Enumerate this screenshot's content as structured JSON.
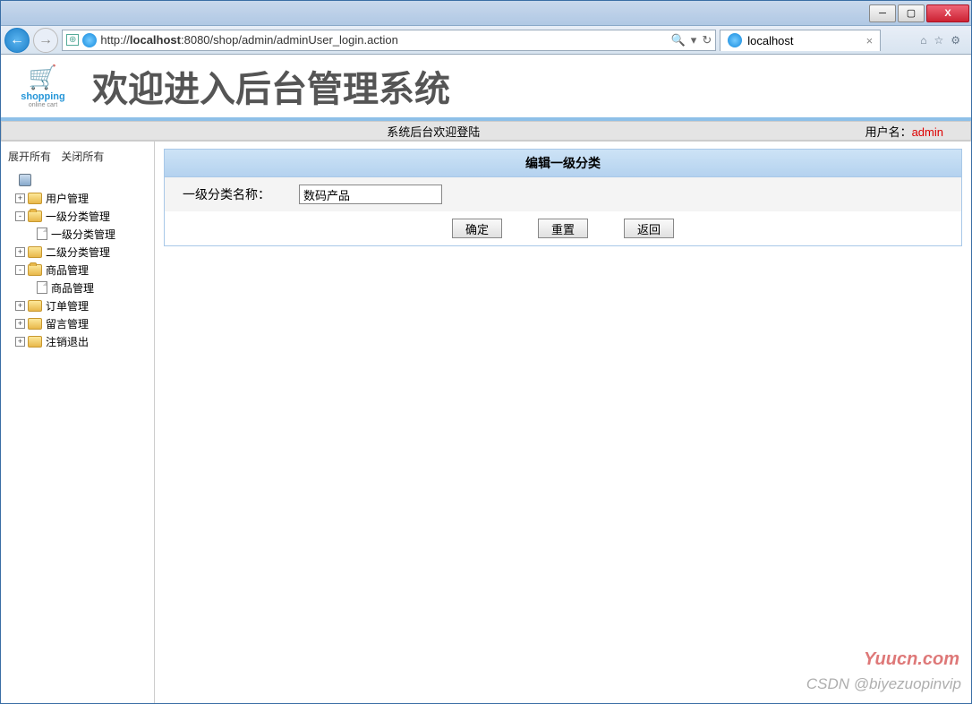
{
  "window": {
    "min_label": "─",
    "max_label": "▢",
    "close_label": "X"
  },
  "addressbar": {
    "url_prefix": "http://",
    "url_host": "localhost",
    "url_rest": ":8080/shop/admin/adminUser_login.action",
    "search_icon": "🔍",
    "refresh_icon": "↻"
  },
  "tab": {
    "title": "localhost"
  },
  "header": {
    "logo_text": "shopping",
    "logo_sub": "online cart",
    "title": "欢迎进入后台管理系统"
  },
  "infobar": {
    "center": "系统后台欢迎登陆",
    "user_label": "用户名：",
    "user_name": "admin"
  },
  "sidebar": {
    "expand_all": "展开所有",
    "collapse_all": "关闭所有",
    "nodes": {
      "user": "用户管理",
      "cat1": "一级分类管理",
      "cat1_sub": "一级分类管理",
      "cat2": "二级分类管理",
      "product": "商品管理",
      "product_sub": "商品管理",
      "order": "订单管理",
      "message": "留言管理",
      "logout": "注销退出"
    }
  },
  "panel": {
    "title": "编辑一级分类",
    "field_label": "一级分类名称：",
    "field_value": "数码产品",
    "btn_ok": "确定",
    "btn_reset": "重置",
    "btn_back": "返回"
  },
  "watermark": {
    "w1": "Yuucn.com",
    "w2": "CSDN @biyezuopinvip"
  }
}
